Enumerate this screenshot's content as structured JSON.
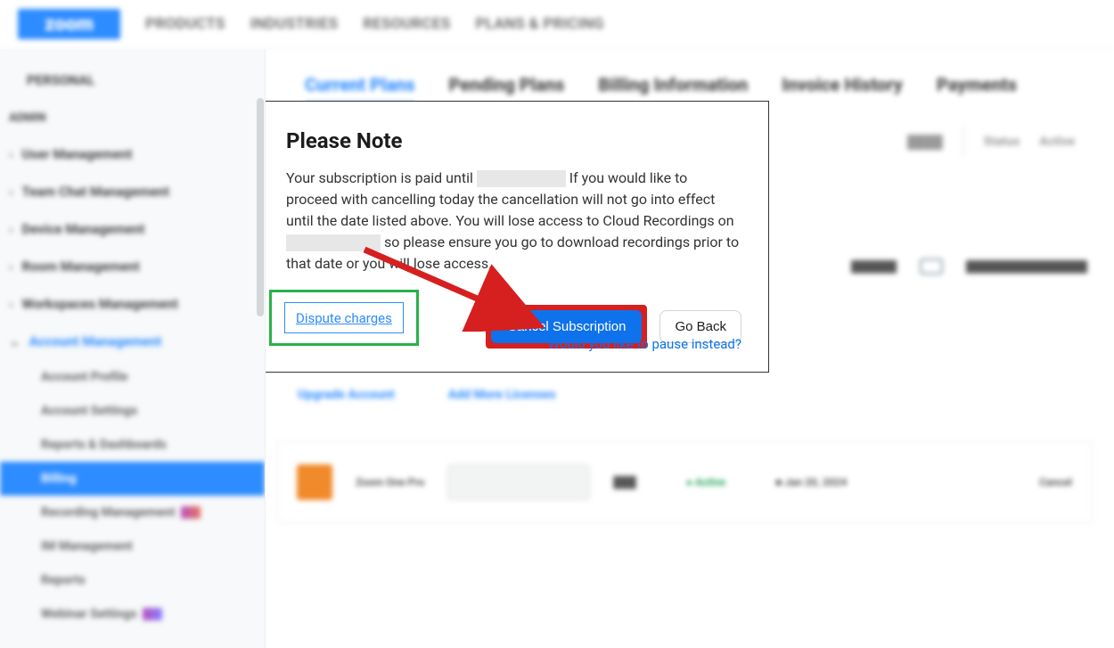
{
  "header": {
    "logo": "zoom",
    "nav": [
      "PRODUCTS",
      "INDUSTRIES",
      "RESOURCES",
      "PLANS & PRICING"
    ]
  },
  "sidebar": {
    "top_heading": "PERSONAL",
    "mid_heading": "ADMIN",
    "groups": [
      {
        "label": "User Management"
      },
      {
        "label": "Team Chat Management"
      },
      {
        "label": "Device Management"
      },
      {
        "label": "Room Management"
      },
      {
        "label": "Workspaces Management"
      },
      {
        "label": "Account Management",
        "active": true
      }
    ],
    "children": [
      {
        "label": "Account Profile"
      },
      {
        "label": "Account Settings"
      },
      {
        "label": "Reports & Dashboards"
      },
      {
        "label": "Billing",
        "active": true
      },
      {
        "label": "Recording Management",
        "badge": "a"
      },
      {
        "label": "IM Management"
      },
      {
        "label": "Reports"
      },
      {
        "label": "Webinar Settings",
        "badge": "c"
      }
    ]
  },
  "tabs": [
    {
      "label": "Current Plans",
      "active": true
    },
    {
      "label": "Pending Plans"
    },
    {
      "label": "Billing Information"
    },
    {
      "label": "Invoice History"
    },
    {
      "label": "Payments"
    }
  ],
  "note": {
    "title": "Please Note",
    "line1a": "Your subscription is paid until ",
    "line1b": " If you would like to proceed with cancelling today the cancellation will not go into effect until the date listed above. You will lose access to Cloud Recordings on ",
    "line1c": " so please ensure you go to download recordings prior to that date or you will lose access.",
    "dispute": "Dispute charges",
    "cancel": "Cancel Subscription",
    "goback": "Go Back",
    "pause": "Would you like to pause instead?"
  },
  "bg_info": {
    "i1": "",
    "i2": "Status",
    "i3": "Active"
  },
  "text_links": [
    "Upgrade Account",
    "Add More Licenses"
  ],
  "bottom": {
    "label": "Zoom One Pro",
    "status": "Active",
    "date": "Jan 20, 2024",
    "action": "Cancel"
  }
}
